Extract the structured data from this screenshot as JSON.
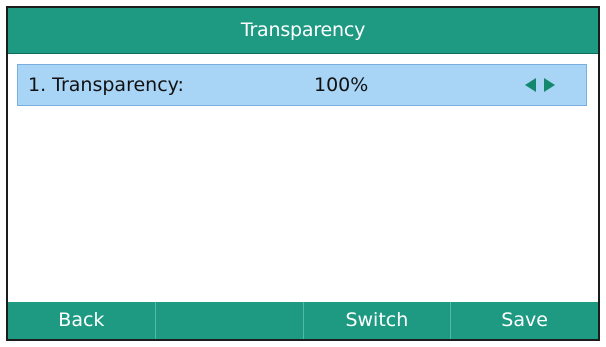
{
  "header": {
    "title": "Transparency"
  },
  "settings": {
    "items": [
      {
        "label": "1. Transparency:",
        "value": "100%",
        "left_icon": "triangle-left-icon",
        "right_icon": "triangle-right-icon"
      }
    ]
  },
  "softkeys": [
    {
      "label": "Back"
    },
    {
      "label": ""
    },
    {
      "label": "Switch"
    },
    {
      "label": "Save"
    }
  ],
  "colors": {
    "header_background": "#1e9a83",
    "selected_row_background": "#a8d4f6",
    "selected_row_border": "#79aede",
    "arrow_color": "#14876f",
    "softkey_background": "#1e9a83"
  }
}
